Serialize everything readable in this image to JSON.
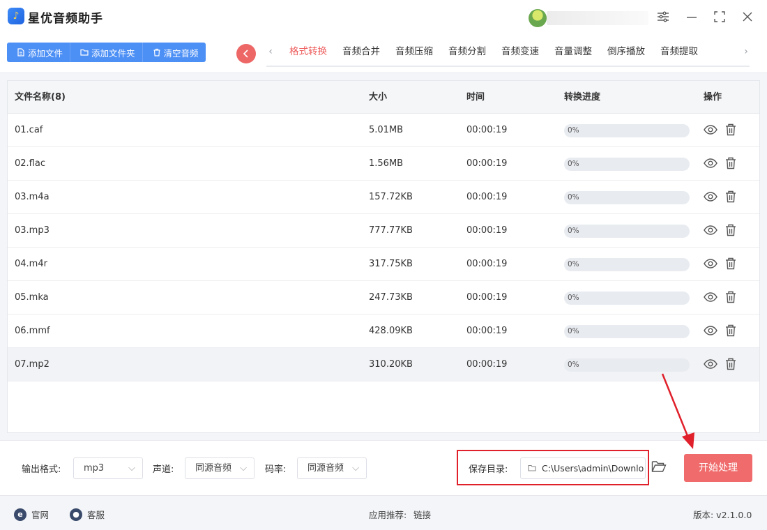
{
  "app": {
    "title": "星优音频助手",
    "logo_icon": "music-note-icon"
  },
  "window_controls": [
    "settings-sliders-icon",
    "minimize-icon",
    "maximize-icon",
    "close-icon"
  ],
  "toolbar": {
    "add_file": "添加文件",
    "add_folder": "添加文件夹",
    "clear_audio": "清空音频"
  },
  "tabs": [
    {
      "label": "格式转换",
      "active": true
    },
    {
      "label": "音频合并"
    },
    {
      "label": "音频压缩"
    },
    {
      "label": "音频分割"
    },
    {
      "label": "音频变速"
    },
    {
      "label": "音量调整"
    },
    {
      "label": "倒序播放"
    },
    {
      "label": "音频提取"
    }
  ],
  "table": {
    "headers": {
      "name": "文件名称(8)",
      "size": "大小",
      "time": "时间",
      "progress": "转换进度",
      "actions": "操作"
    },
    "rows": [
      {
        "name": "01.caf",
        "size": "5.01MB",
        "time": "00:00:19",
        "progress_text": "0%",
        "progress": 0
      },
      {
        "name": "02.flac",
        "size": "1.56MB",
        "time": "00:00:19",
        "progress_text": "0%",
        "progress": 0
      },
      {
        "name": "03.m4a",
        "size": "157.72KB",
        "time": "00:00:19",
        "progress_text": "0%",
        "progress": 0
      },
      {
        "name": "03.mp3",
        "size": "777.77KB",
        "time": "00:00:19",
        "progress_text": "0%",
        "progress": 0
      },
      {
        "name": "04.m4r",
        "size": "317.75KB",
        "time": "00:00:19",
        "progress_text": "0%",
        "progress": 0
      },
      {
        "name": "05.mka",
        "size": "247.73KB",
        "time": "00:00:19",
        "progress_text": "0%",
        "progress": 0
      },
      {
        "name": "06.mmf",
        "size": "428.09KB",
        "time": "00:00:19",
        "progress_text": "0%",
        "progress": 0
      },
      {
        "name": "07.mp2",
        "size": "310.20KB",
        "time": "00:00:19",
        "progress_text": "0%",
        "progress": 0,
        "selected": true
      }
    ]
  },
  "settings": {
    "format_label": "输出格式:",
    "format_value": "mp3",
    "channel_label": "声道:",
    "channel_value": "同源音频",
    "bitrate_label": "码率:",
    "bitrate_value": "同源音频",
    "save_dir_label": "保存目录:",
    "save_dir_value": "C:\\Users\\admin\\Downlo",
    "start_button": "开始处理"
  },
  "footer": {
    "website": "官网",
    "support": "客服",
    "recommend_label": "应用推荐:",
    "recommend_link": "链接",
    "version": "版本: v2.1.0.0"
  },
  "colors": {
    "primary": "#4c8ff5",
    "accent": "#ee6767",
    "highlight": "#e0202b"
  }
}
